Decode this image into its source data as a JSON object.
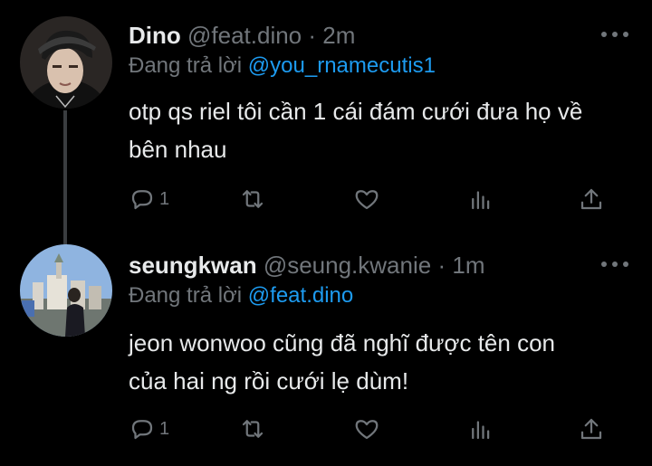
{
  "tweets": [
    {
      "name": "Dino",
      "handle": "@feat.dino",
      "separator": "·",
      "time": "2m",
      "reply_label": "Đang trả lời",
      "reply_handle": "@you_rnamecutis1",
      "text_line1": "otp qs riel tôi cần 1 cái đám cưới đưa họ về",
      "text_line2": "bên nhau",
      "reply_count": "1",
      "avatar": "person-avatar-dark-cap"
    },
    {
      "name": "seungkwan",
      "handle": "@seung.kwanie",
      "separator": "·",
      "time": "1m",
      "reply_label": "Đang trả lời",
      "reply_handle": "@feat.dino",
      "text_line1": "jeon wonwoo cũng đã nghĩ được tên con",
      "text_line2": "của hai ng rồi cưới lẹ dùm!",
      "reply_count": "1",
      "avatar": "person-avatar-city-sky"
    }
  ],
  "colors": {
    "background": "#000000",
    "text": "#e7e9ea",
    "muted": "#71767b",
    "link": "#1d9bf0"
  },
  "icons": [
    "reply-icon",
    "retweet-icon",
    "like-icon",
    "views-icon",
    "share-icon",
    "more-icon"
  ]
}
